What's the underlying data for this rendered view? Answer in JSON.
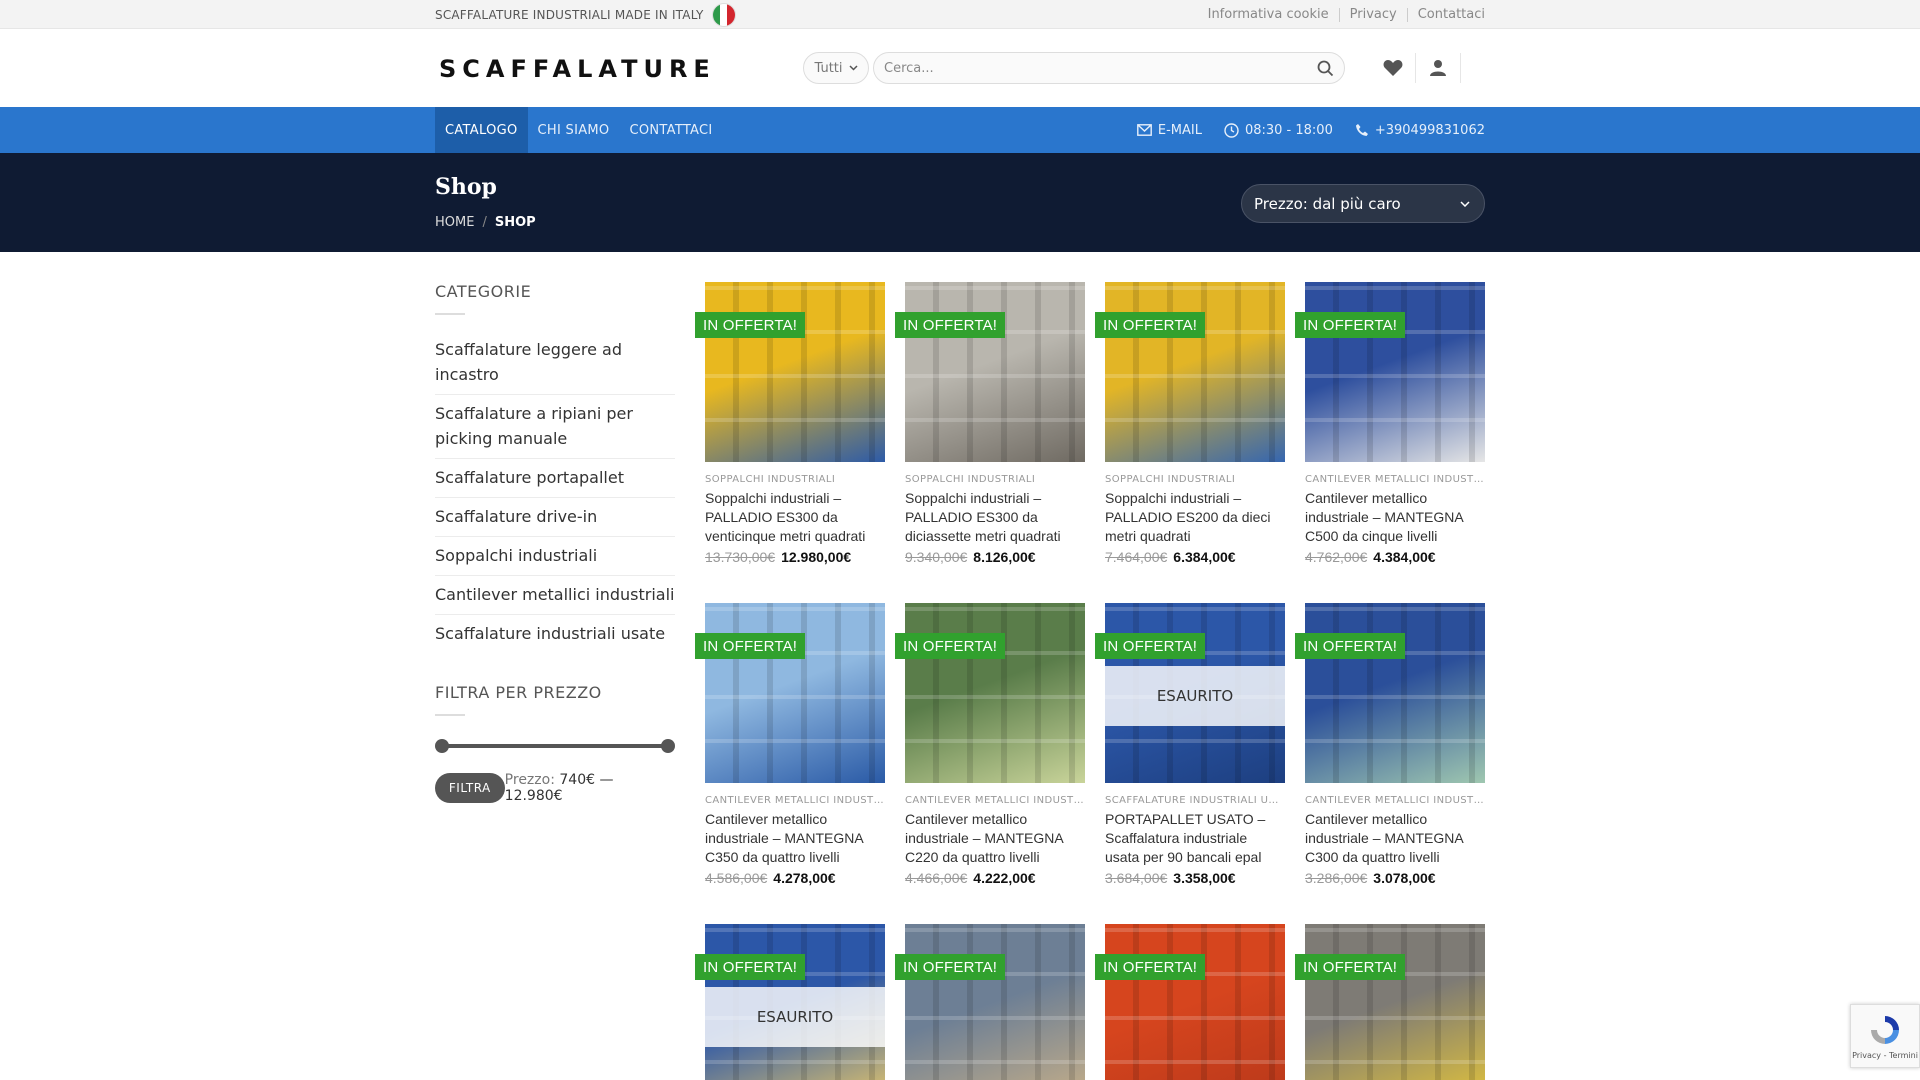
{
  "topbar": {
    "tagline": "SCAFFALATURE INDUSTRIALI MADE IN ITALY",
    "links": [
      "Informativa cookie",
      "Privacy",
      "Contattaci"
    ]
  },
  "header": {
    "logo_text": "SCAFFALATURE",
    "category_select": "Tutti",
    "search_placeholder": "Cerca..."
  },
  "nav": {
    "items": [
      "CATALOGO",
      "CHI SIAMO",
      "CONTATTACI"
    ],
    "email": "E-MAIL",
    "hours": "08:30 - 18:00",
    "phone": "+390499831062"
  },
  "shop": {
    "title": "Shop",
    "breadcrumb": [
      "HOME",
      "SHOP"
    ],
    "sort": "Prezzo: dal più caro"
  },
  "sidebar": {
    "categories_title": "CATEGORIE",
    "categories": [
      "Scaffalature leggere ad incastro",
      "Scaffalature a ripiani per picking manuale",
      "Scaffalature portapallet",
      "Scaffalature drive-in",
      "Soppalchi industriali",
      "Cantilever metallici industriali",
      "Scaffalature industriali usate"
    ],
    "filter_title": "FILTRA PER PREZZO",
    "filter_button": "FILTRA",
    "price_prefix": "Prezzo:",
    "price_range": "740€ — 12.980€"
  },
  "badge_label": "IN OFFERTA!",
  "sold_out_label": "ESAURITO",
  "products": [
    {
      "category": "SOPPALCHI INDUSTRIALI",
      "name": "Soppalchi industriali – PALLADIO ES300 da venticinque metri quadrati",
      "old": "13.730,00€",
      "new": "12.980,00€",
      "color_a": "#e8b81f",
      "color_b": "#2d5ba8",
      "sold_out": false
    },
    {
      "category": "SOPPALCHI INDUSTRIALI",
      "name": "Soppalchi industriali – PALLADIO ES300 da diciassette metri quadrati",
      "old": "9.340,00€",
      "new": "8.126,00€",
      "color_a": "#b9b6ae",
      "color_b": "#6f6a62",
      "sold_out": false
    },
    {
      "category": "SOPPALCHI INDUSTRIALI",
      "name": "Soppalchi industriali – PALLADIO ES200 da dieci metri quadrati",
      "old": "7.464,00€",
      "new": "6.384,00€",
      "color_a": "#e2b526",
      "color_b": "#3566b0",
      "sold_out": false
    },
    {
      "category": "CANTILEVER METALLICI INDUSTRIALI",
      "name": "Cantilever metallico industriale – MANTEGNA C500 da cinque livelli",
      "old": "4.762,00€",
      "new": "4.384,00€",
      "color_a": "#2e4f9e",
      "color_b": "#e6e6e6",
      "sold_out": false
    },
    {
      "category": "CANTILEVER METALLICI INDUSTRIALI",
      "name": "Cantilever metallico industriale – MANTEGNA C350 da quattro livelli",
      "old": "4.586,00€",
      "new": "4.278,00€",
      "color_a": "#8fb8e0",
      "color_b": "#2a5aa6",
      "sold_out": false
    },
    {
      "category": "CANTILEVER METALLICI INDUSTRIALI",
      "name": "Cantilever metallico industriale – MANTEGNA C220 da quattro livelli",
      "old": "4.466,00€",
      "new": "4.222,00€",
      "color_a": "#5a7d4a",
      "color_b": "#c9d49a",
      "sold_out": false
    },
    {
      "category": "SCAFFALATURE INDUSTRIALI USATE",
      "name": "PORTAPALLET USATO – Scaffalatura industriale usata per 90 bancali epal",
      "old": "3.684,00€",
      "new": "3.358,00€",
      "color_a": "#2c57a8",
      "color_b": "#1d3f80",
      "sold_out": true
    },
    {
      "category": "CANTILEVER METALLICI INDUSTRIALI",
      "name": "Cantilever metallico industriale – MANTEGNA C300 da quattro livelli",
      "old": "3.286,00€",
      "new": "3.078,00€",
      "color_a": "#2b4f9a",
      "color_b": "#9fc7b0",
      "sold_out": false
    },
    {
      "category": "",
      "name": "",
      "old": "",
      "new": "",
      "color_a": "#2c57a8",
      "color_b": "#e8c86a",
      "sold_out": true
    },
    {
      "category": "",
      "name": "",
      "old": "",
      "new": "",
      "color_a": "#6d7f95",
      "color_b": "#c8b088",
      "sold_out": false
    },
    {
      "category": "",
      "name": "",
      "old": "",
      "new": "",
      "color_a": "#d6451e",
      "color_b": "#b8381a",
      "sold_out": false
    },
    {
      "category": "",
      "name": "",
      "old": "",
      "new": "",
      "color_a": "#7e7b75",
      "color_b": "#e3c43a",
      "sold_out": false
    }
  ],
  "recaptcha_text": "Privacy - Termini"
}
